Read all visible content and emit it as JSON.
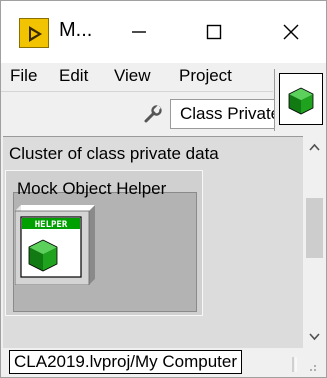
{
  "window": {
    "title": "M...",
    "minimize_glyph": "—",
    "maximize_glyph": "☐",
    "close_glyph": "✕"
  },
  "menu": {
    "items": [
      "File",
      "Edit",
      "View",
      "Project"
    ]
  },
  "toolbar": {
    "dropdown_value": "Class Private Data",
    "wrench_icon": "wrench-icon"
  },
  "content": {
    "cluster_label": "Cluster of class private data",
    "control_label": "Mock Object Helper",
    "helper_icon_text": "HELPER"
  },
  "status": {
    "path": "CLA2019.lvproj/My Computer"
  },
  "colors": {
    "app_icon": "#f2c300",
    "class_cube": "#1fa31f",
    "helper_banner": "#00a000"
  }
}
